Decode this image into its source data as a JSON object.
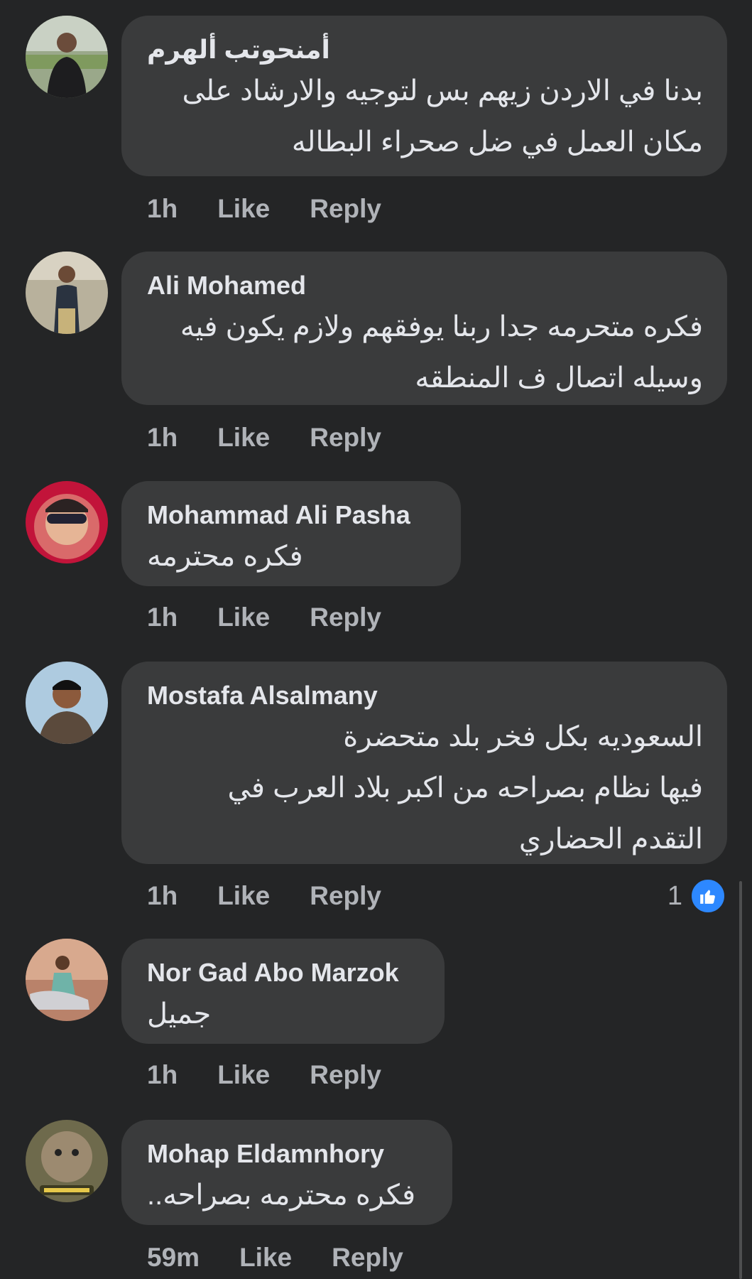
{
  "comments": [
    {
      "author": "أمنحوتب ألهرم",
      "lines": [
        "بدنا في الاردن زيهم بس لتوجيه والارشاد على",
        "مكان العمل في ضل صحراء البطاله"
      ],
      "time": "1h",
      "like_label": "Like",
      "reply_label": "Reply"
    },
    {
      "author": "Ali Mohamed",
      "lines": [
        "فكره متحرمه جدا ربنا يوفقهم ولازم يكون فيه",
        "وسيله اتصال ف المنطقه"
      ],
      "time": "1h",
      "like_label": "Like",
      "reply_label": "Reply"
    },
    {
      "author": "Mohammad Ali Pasha",
      "lines": [
        "فكره محترمه"
      ],
      "time": "1h",
      "like_label": "Like",
      "reply_label": "Reply"
    },
    {
      "author": "Mostafa Alsalmany",
      "lines": [
        "السعوديه بكل فخر بلد متحضرة",
        "فيها نظام بصراحه من اكبر بلاد العرب في",
        "التقدم الحضاري"
      ],
      "time": "1h",
      "like_label": "Like",
      "reply_label": "Reply",
      "reaction_count": "1"
    },
    {
      "author": "Nor Gad Abo Marzok",
      "lines": [
        "جميل"
      ],
      "time": "1h",
      "like_label": "Like",
      "reply_label": "Reply"
    },
    {
      "author": "Mohap Eldamnhory",
      "lines": [
        "فكره محترمه بصراحه.."
      ],
      "time": "59m",
      "like_label": "Like",
      "reply_label": "Reply"
    }
  ],
  "colors": {
    "background": "#242526",
    "bubble": "#3a3b3c",
    "text": "#e4e6eb",
    "secondary_text": "#b0b3b8",
    "like_blue": "#2d88ff"
  },
  "icons": {
    "reaction": "like-thumb-icon"
  }
}
